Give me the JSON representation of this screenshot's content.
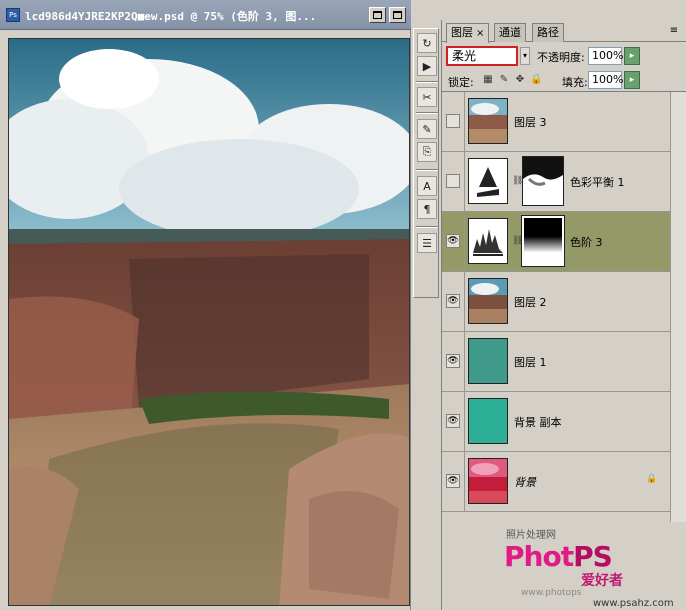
{
  "document": {
    "title": "lcd986d4YJRE2KP2Q■ew.psd @ 75% (色阶 3, 图...",
    "app_icon_text": "Ps",
    "minimize_label": "",
    "maximize_label": ""
  },
  "tools": [
    "history",
    "actions",
    "tool-presets",
    "brushes",
    "clone-source",
    "character",
    "paragraph",
    "notes"
  ],
  "panel": {
    "tabs": [
      {
        "label": "图层",
        "active": true,
        "closable": true
      },
      {
        "label": "通道",
        "active": false
      },
      {
        "label": "路径",
        "active": false
      }
    ],
    "blend_mode": "柔光",
    "opacity_label": "不透明度:",
    "opacity_value": "100%",
    "lock_label": "锁定:",
    "fill_label": "填充:",
    "fill_value": "100%",
    "layers": [
      {
        "name": "图层 3",
        "visible": false,
        "kind": "photo",
        "italic": false,
        "selected": false,
        "has_mask": false,
        "locked": false
      },
      {
        "name": "色彩平衡 1",
        "visible": false,
        "kind": "adjustment-balance",
        "italic": false,
        "selected": false,
        "has_mask": true,
        "locked": false
      },
      {
        "name": "色阶 3",
        "visible": true,
        "kind": "adjustment-levels",
        "italic": false,
        "selected": true,
        "has_mask": true,
        "locked": false
      },
      {
        "name": "图层 2",
        "visible": true,
        "kind": "photo",
        "italic": false,
        "selected": false,
        "has_mask": false,
        "locked": false
      },
      {
        "name": "图层 1",
        "visible": true,
        "kind": "fill",
        "fill_color": "#3f9a89",
        "italic": false,
        "selected": false,
        "has_mask": false,
        "locked": false
      },
      {
        "name": "背景 副本",
        "visible": true,
        "kind": "fill",
        "fill_color": "#2db097",
        "italic": false,
        "selected": false,
        "has_mask": false,
        "locked": false
      },
      {
        "name": "背景",
        "visible": true,
        "kind": "red-photo",
        "italic": true,
        "selected": false,
        "has_mask": false,
        "locked": true
      }
    ]
  },
  "watermark": {
    "top_text": "照片处理网",
    "logo_a": "Phot",
    "logo_b": "PS",
    "aihao": "爱好者",
    "url_left": "www.photops",
    "url_right": "www.psahz.com"
  },
  "colors": {
    "selected_row": "#949968",
    "blend_border": "#d02020",
    "go_button": "#6aa070"
  }
}
